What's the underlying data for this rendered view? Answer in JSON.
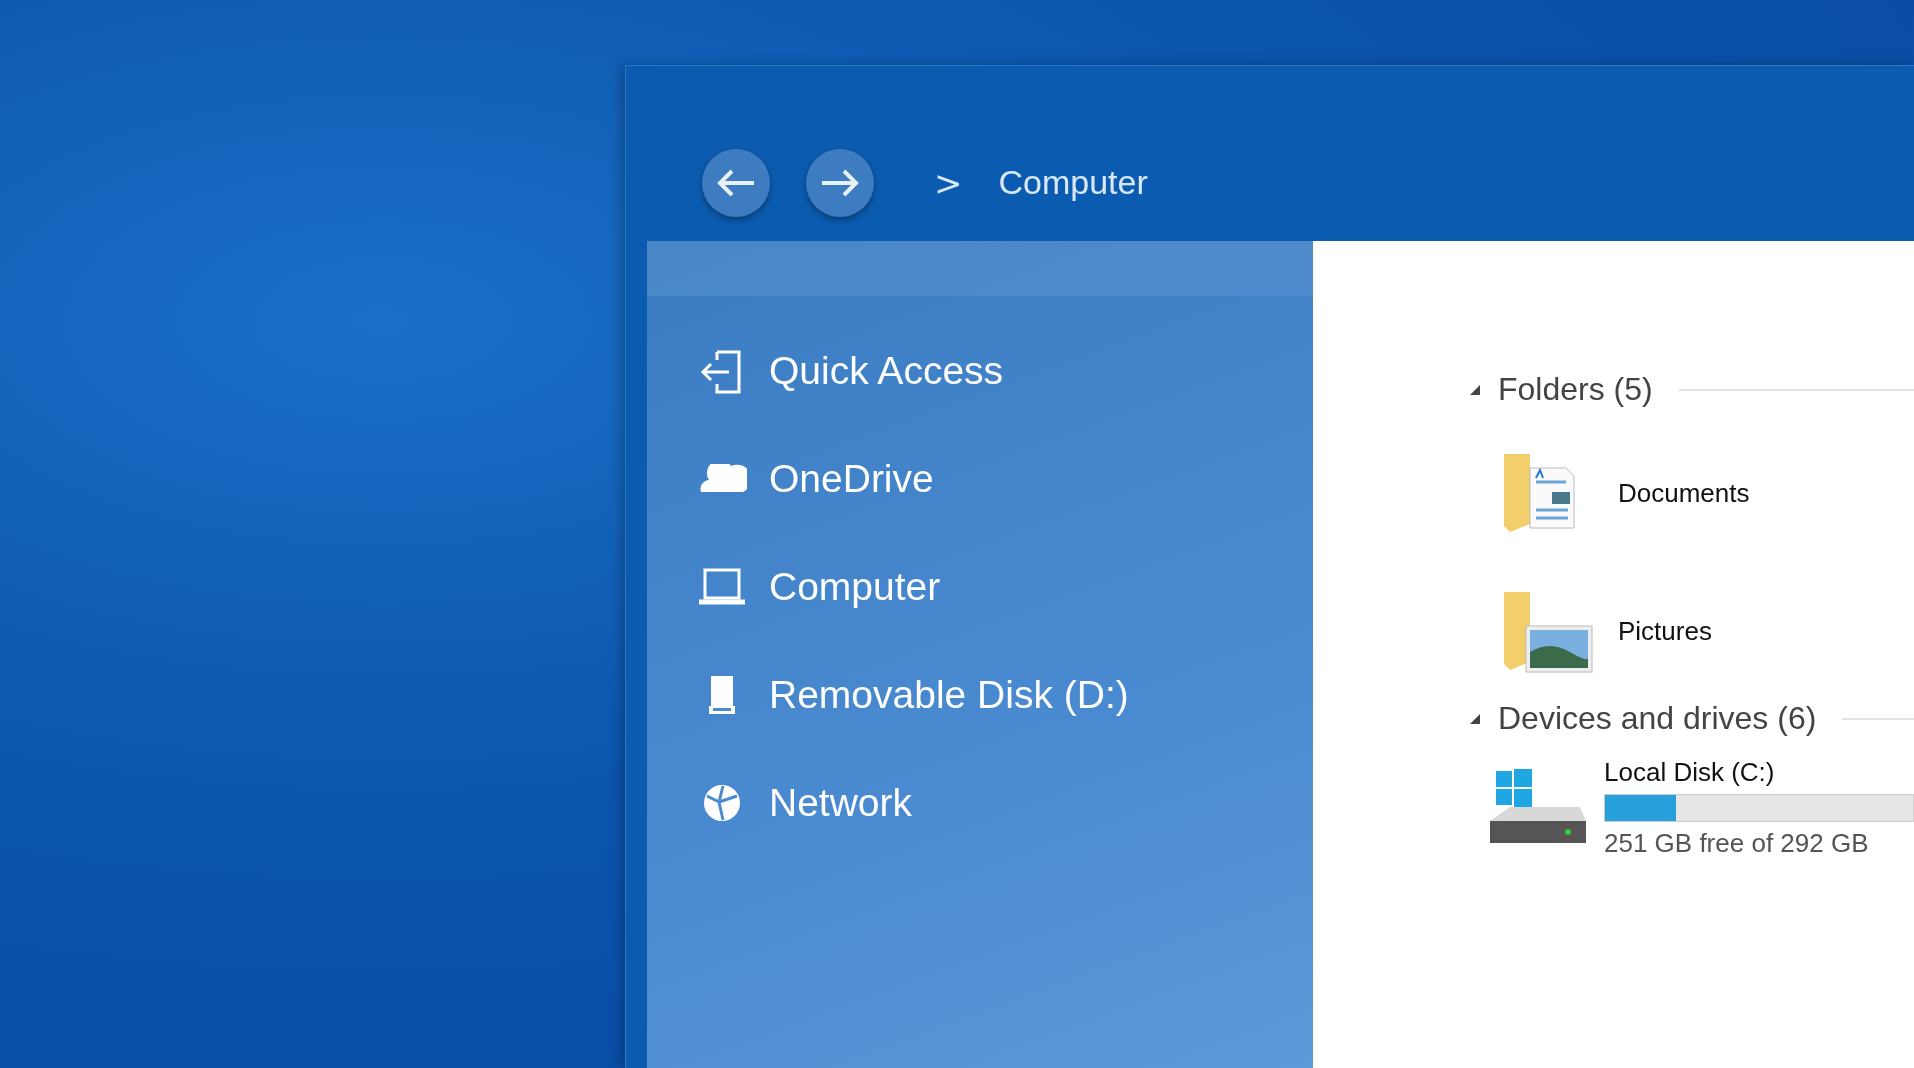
{
  "breadcrumb": {
    "separator": ">",
    "current": "Computer"
  },
  "sidebar": {
    "items": [
      {
        "kind": "quick-access",
        "label": "Quick Access",
        "selected": false
      },
      {
        "kind": "cloud",
        "label": "OneDrive",
        "selected": false
      },
      {
        "kind": "computer",
        "label": "Computer",
        "selected": false
      },
      {
        "kind": "removable",
        "label": "Removable Disk (D:)",
        "selected": false
      },
      {
        "kind": "network",
        "label": "Network",
        "selected": false
      }
    ]
  },
  "groups": [
    {
      "title": "Folders (5)",
      "expanded": true,
      "items": [
        {
          "kind": "documents",
          "name": "Documents"
        },
        {
          "kind": "pictures",
          "name": "Pictures"
        }
      ]
    },
    {
      "title": "Devices and drives (6)",
      "expanded": true,
      "items": [
        {
          "kind": "drive",
          "name": "Local Disk (C:)",
          "level": 0.23,
          "detail": "251 GB free of 292 GB"
        }
      ]
    }
  ]
}
